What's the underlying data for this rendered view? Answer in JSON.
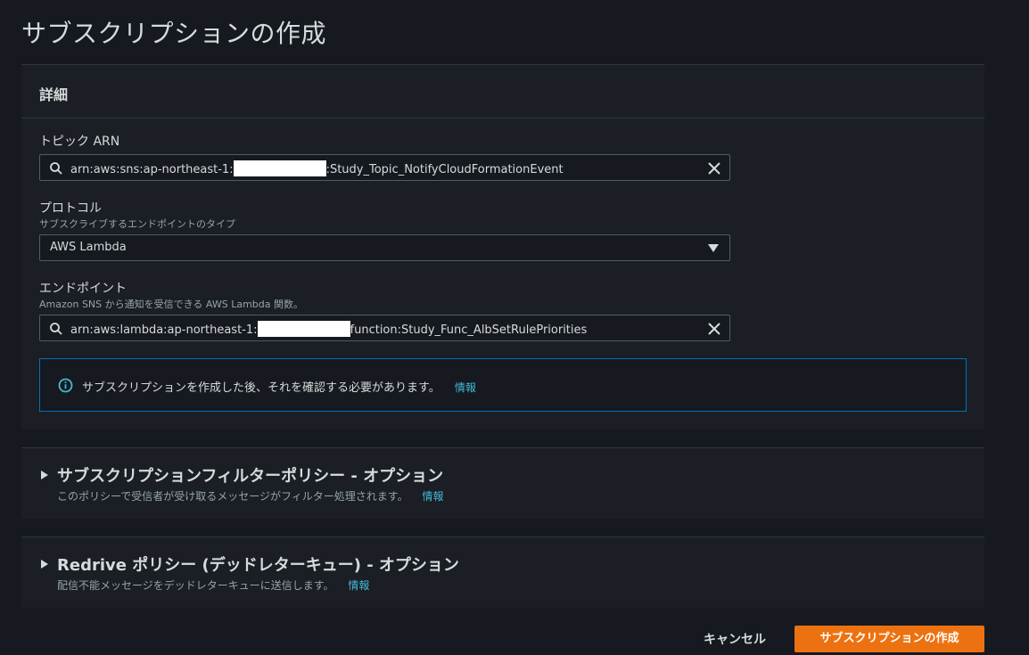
{
  "page": {
    "title": "サブスクリプションの作成"
  },
  "details": {
    "header": "詳細",
    "topic_arn": {
      "label": "トピック ARN",
      "value_prefix": "arn:aws:sns:ap-northeast-1:",
      "value_suffix": ":Study_Topic_NotifyCloudFormationEvent"
    },
    "protocol": {
      "label": "プロトコル",
      "description": "サブスクライブするエンドポイントのタイプ",
      "selected": "AWS Lambda"
    },
    "endpoint": {
      "label": "エンドポイント",
      "description": "Amazon SNS から通知を受信できる AWS Lambda 関数。",
      "value_prefix": "arn:aws:lambda:ap-northeast-1:",
      "value_suffix": "function:Study_Func_AlbSetRulePriorities"
    },
    "alert": {
      "message": "サブスクリプションを作成した後、それを確認する必要があります。",
      "link": "情報"
    }
  },
  "filter_policy": {
    "title": "サブスクリプションフィルターポリシー - オプション",
    "description": "このポリシーで受信者が受け取るメッセージがフィルター処理されます。",
    "link": "情報"
  },
  "redrive_policy": {
    "title": "Redrive ポリシー (デッドレターキュー) - オプション",
    "description": "配信不能メッセージをデッドレターキューに送信します。",
    "link": "情報"
  },
  "actions": {
    "cancel": "キャンセル",
    "create": "サブスクリプションの作成"
  },
  "colors": {
    "primary_button": "#ec7211",
    "info_border": "#0073bb",
    "link": "#44b9d6"
  },
  "icons": [
    "search-icon",
    "clear-icon",
    "caret-down-icon",
    "info-icon",
    "expand-triangle-icon"
  ]
}
